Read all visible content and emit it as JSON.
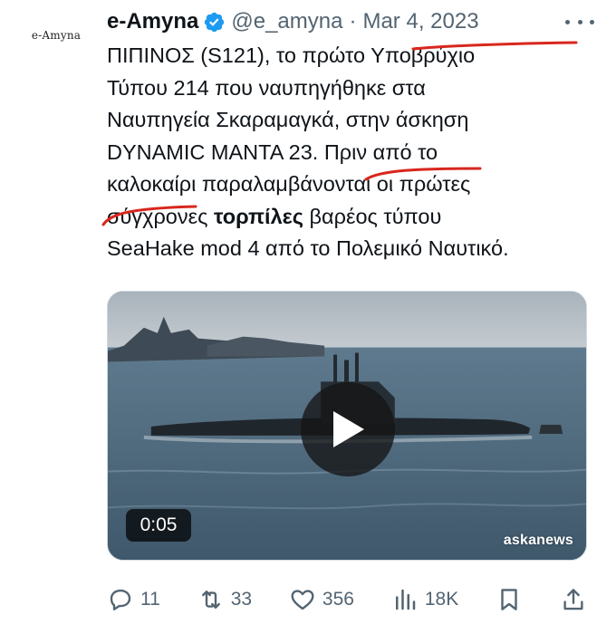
{
  "avatar": {
    "label": "e-Amyna"
  },
  "header": {
    "display_name": "e-Amyna",
    "handle": "@e_amyna",
    "separator": "·",
    "date": "Mar 4, 2023"
  },
  "tweet": {
    "line1": "ΠΙΠΙΝΟΣ (S121), το πρώτο Υποβρύχιο",
    "line2": "Τύπου 214 που ναυπηγήθηκε στα",
    "line3": "Ναυπηγεία Σκαραμαγκά, στην άσκηση",
    "line4": "DYNAMIC MANTA 23. Πριν από το",
    "line5": "καλοκαίρι παραλαμβάνονται οι πρώτες",
    "line6_pre": "σύγχρονες ",
    "line6_bold": "τορπίλες",
    "line6_post": " βαρέος τύπου",
    "line7": "SeaHake mod 4 από το Πολεμικό Ναυτικό."
  },
  "video": {
    "duration": "0:05",
    "watermark": "askanews"
  },
  "actions": {
    "replies": "11",
    "reposts": "33",
    "likes": "356",
    "views": "18K"
  },
  "colors": {
    "text": "#0f1419",
    "secondary": "#536471",
    "verified": "#1d9bf0",
    "annotation_red": "#d8271d"
  },
  "icons": [
    "verified-badge-icon",
    "more-dots-icon",
    "play-icon",
    "reply-icon",
    "repost-icon",
    "like-icon",
    "views-icon",
    "bookmark-icon",
    "share-icon"
  ]
}
